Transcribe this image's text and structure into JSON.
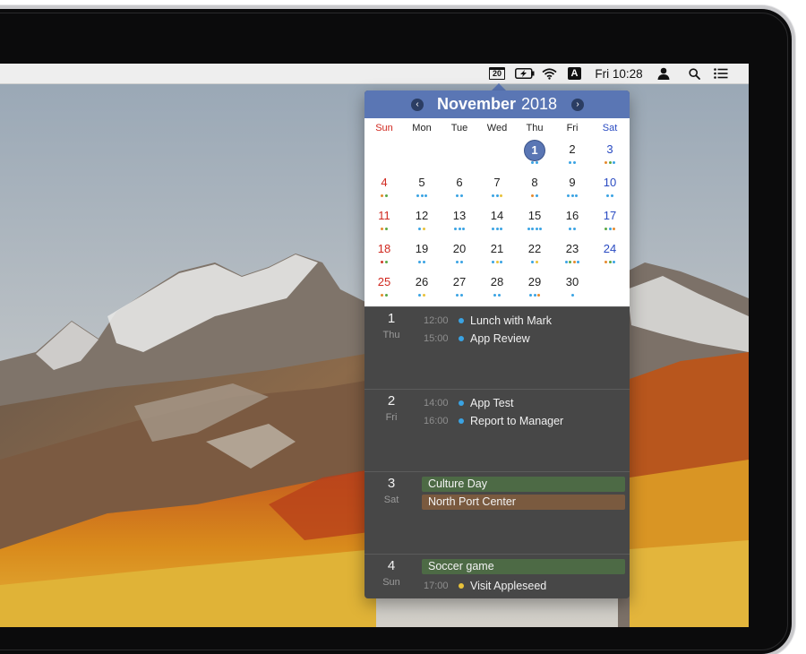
{
  "menubar": {
    "date_icon_text": "20",
    "clock": "Fri 10:28",
    "input_source": "A",
    "icons": [
      "calendar-date-icon",
      "battery-icon",
      "wifi-icon",
      "input-source-icon",
      "user-icon",
      "spotlight-search-icon",
      "notification-center-icon"
    ]
  },
  "calendar": {
    "month": "November",
    "year": "2018",
    "weekdays": [
      "Sun",
      "Mon",
      "Tue",
      "Wed",
      "Thu",
      "Fri",
      "Sat"
    ],
    "today": "1",
    "colors": {
      "header": "#5a76b4",
      "sunday": "#d0281f",
      "saturday": "#2a4bc2",
      "event_blue": "#3aa3e3",
      "event_green": "#5aa844",
      "event_orange": "#e68a2e",
      "event_red": "#d03a2a",
      "event_yellow": "#e8c23a"
    },
    "weeks": [
      [
        null,
        null,
        null,
        null,
        {
          "n": "1",
          "dots": [
            "blue",
            "blue"
          ]
        },
        {
          "n": "2",
          "dots": [
            "blue",
            "blue"
          ]
        },
        {
          "n": "3",
          "dots": [
            "orange",
            "green",
            "blue"
          ]
        }
      ],
      [
        {
          "n": "4",
          "dots": [
            "orange",
            "green"
          ]
        },
        {
          "n": "5",
          "dots": [
            "blue",
            "blue",
            "blue"
          ]
        },
        {
          "n": "6",
          "dots": [
            "blue",
            "blue"
          ]
        },
        {
          "n": "7",
          "dots": [
            "blue",
            "blue",
            "yellow"
          ]
        },
        {
          "n": "8",
          "dots": [
            "orange",
            "blue"
          ]
        },
        {
          "n": "9",
          "dots": [
            "blue",
            "blue",
            "blue"
          ]
        },
        {
          "n": "10",
          "dots": [
            "blue",
            "blue"
          ]
        }
      ],
      [
        {
          "n": "11",
          "dots": [
            "orange",
            "green"
          ]
        },
        {
          "n": "12",
          "dots": [
            "blue",
            "yellow"
          ]
        },
        {
          "n": "13",
          "dots": [
            "blue",
            "blue",
            "blue"
          ]
        },
        {
          "n": "14",
          "dots": [
            "blue",
            "blue",
            "blue"
          ]
        },
        {
          "n": "15",
          "dots": [
            "blue",
            "blue",
            "blue",
            "blue"
          ]
        },
        {
          "n": "16",
          "dots": [
            "blue",
            "blue"
          ]
        },
        {
          "n": "17",
          "dots": [
            "green",
            "blue",
            "orange"
          ]
        }
      ],
      [
        {
          "n": "18",
          "dots": [
            "red",
            "green"
          ]
        },
        {
          "n": "19",
          "dots": [
            "blue",
            "blue"
          ]
        },
        {
          "n": "20",
          "dots": [
            "blue",
            "blue"
          ]
        },
        {
          "n": "21",
          "dots": [
            "blue",
            "yellow",
            "blue"
          ]
        },
        {
          "n": "22",
          "dots": [
            "blue",
            "yellow"
          ]
        },
        {
          "n": "23",
          "dots": [
            "blue",
            "green",
            "orange",
            "blue"
          ]
        },
        {
          "n": "24",
          "dots": [
            "orange",
            "green",
            "blue"
          ]
        }
      ],
      [
        {
          "n": "25",
          "dots": [
            "orange",
            "green"
          ]
        },
        {
          "n": "26",
          "dots": [
            "blue",
            "yellow"
          ]
        },
        {
          "n": "27",
          "dots": [
            "blue",
            "blue"
          ]
        },
        {
          "n": "28",
          "dots": [
            "blue",
            "blue"
          ]
        },
        {
          "n": "29",
          "dots": [
            "blue",
            "blue",
            "orange"
          ]
        },
        {
          "n": "30",
          "dots": [
            "blue"
          ]
        },
        null
      ]
    ]
  },
  "agenda": [
    {
      "num": "1",
      "weekday": "Thu",
      "allday": [],
      "events": [
        {
          "time": "12:00",
          "title": "Lunch with Mark",
          "color": "#3aa3e3"
        },
        {
          "time": "15:00",
          "title": "App Review",
          "color": "#3aa3e3"
        }
      ]
    },
    {
      "num": "2",
      "weekday": "Fri",
      "allday": [],
      "events": [
        {
          "time": "14:00",
          "title": "App Test",
          "color": "#3aa3e3"
        },
        {
          "time": "16:00",
          "title": "Report to Manager",
          "color": "#3aa3e3"
        }
      ]
    },
    {
      "num": "3",
      "weekday": "Sat",
      "allday": [
        {
          "title": "Culture Day",
          "color": "#4d6a45"
        },
        {
          "title": "North Port Center",
          "color": "#7a5a3f"
        }
      ],
      "events": []
    },
    {
      "num": "4",
      "weekday": "Sun",
      "allday": [
        {
          "title": "Soccer game",
          "color": "#4d6a45"
        }
      ],
      "events": [
        {
          "time": "17:00",
          "title": "Visit Appleseed",
          "color": "#e8c23a"
        }
      ]
    }
  ]
}
